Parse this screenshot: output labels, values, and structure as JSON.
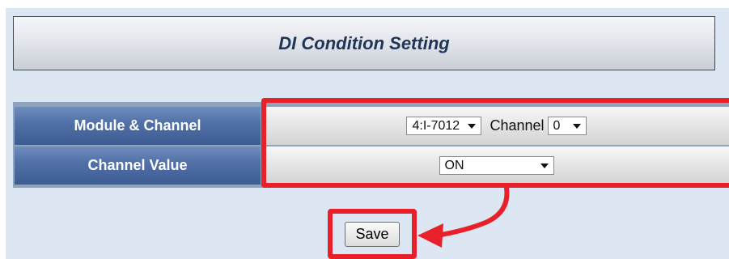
{
  "form": {
    "title": "DI Condition Setting",
    "rows": [
      {
        "label": "Module & Channel"
      },
      {
        "label": "Channel Value"
      }
    ],
    "module_select": {
      "value": "4:I-7012"
    },
    "channel_label": "Channel",
    "channel_select": {
      "value": "0"
    },
    "channel_value_select": {
      "value": "ON"
    },
    "save_label": "Save"
  },
  "annotation": {
    "highlight_color": "#e8202a"
  }
}
